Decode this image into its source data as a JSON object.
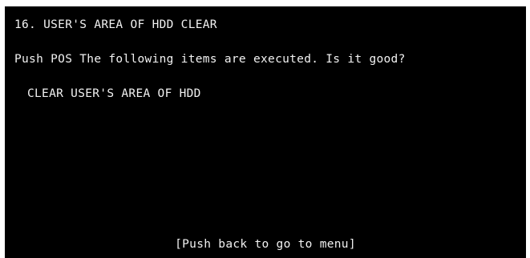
{
  "screen": {
    "title": "16. USER'S AREA OF HDD CLEAR",
    "prompt": "Push POS The following items are executed. Is it good?",
    "items": [
      "CLEAR USER'S AREA OF HDD"
    ],
    "footer": "[Push back to go to menu]"
  },
  "colors": {
    "background": "#000000",
    "text": "#f2f2f2"
  }
}
